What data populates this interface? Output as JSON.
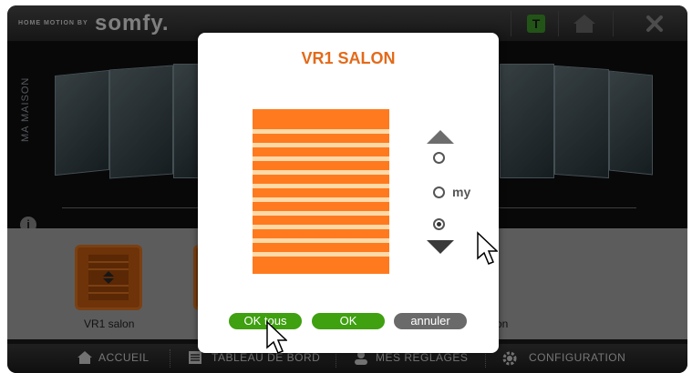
{
  "header": {
    "brand_tagline": "HOME MOTION BY",
    "brand_logo": "somfy.",
    "buttons": [
      {
        "name": "t-icon",
        "color": "#3f9a2b",
        "symbol": "T"
      },
      {
        "name": "home-icon",
        "color": "#6b6b6b"
      },
      {
        "name": "close-icon",
        "color": "#8a8a8a",
        "symbol": "✖"
      }
    ]
  },
  "house": {
    "side_label": "MA MAISON"
  },
  "devices": [
    {
      "label": "VR1 salon"
    },
    {
      "label": "on"
    }
  ],
  "nav": {
    "items": [
      {
        "label": "ACCUEIL",
        "icon": "home-icon"
      },
      {
        "label": "TABLEAU DE BORD",
        "icon": "dashboard-icon"
      },
      {
        "label": "MES RÉGLAGES",
        "icon": "user-icon"
      },
      {
        "label": "CONFIGURATION",
        "icon": "gear-icon"
      }
    ]
  },
  "dialog": {
    "title": "VR1 SALON",
    "my_label": "my",
    "selected_position": "down",
    "buttons": {
      "ok_all": "OK tous",
      "ok": "OK",
      "cancel": "annuler"
    },
    "colors": {
      "accent": "#e36a1a",
      "shutter": "#ff7a1f",
      "slat": "#ffd9a8",
      "ok": "#3fa010",
      "cancel": "#6a6a6a"
    }
  }
}
